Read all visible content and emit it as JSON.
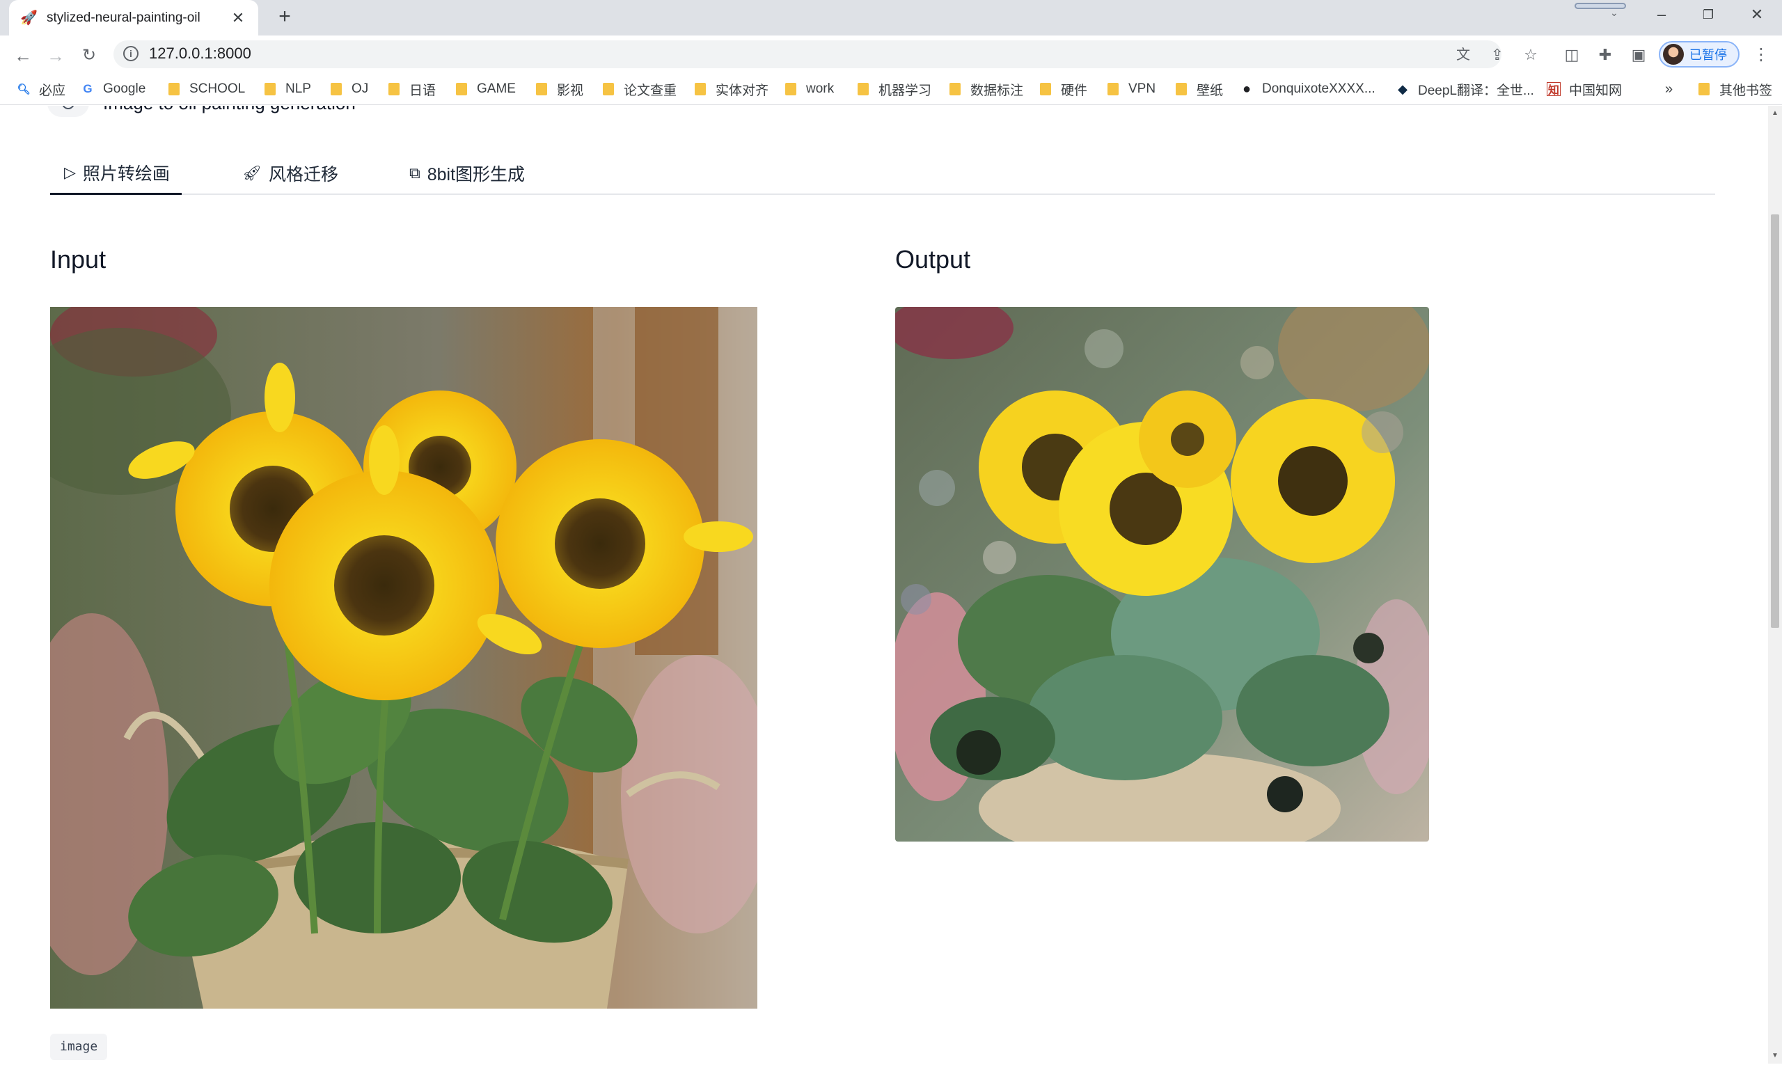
{
  "browser": {
    "tab_title": "stylized-neural-painting-oil",
    "tab_favicon": "🚀",
    "new_tab_symbol": "+",
    "url": "127.0.0.1:8000",
    "profile_label": "已暂停"
  },
  "bookmarks": [
    {
      "label": "必应",
      "icon": "search-icon"
    },
    {
      "label": "Google",
      "icon": "google-icon"
    },
    {
      "label": "SCHOOL",
      "icon": "folder-icon"
    },
    {
      "label": "NLP",
      "icon": "folder-icon"
    },
    {
      "label": "OJ",
      "icon": "folder-icon"
    },
    {
      "label": "日语",
      "icon": "folder-icon"
    },
    {
      "label": "GAME",
      "icon": "folder-icon"
    },
    {
      "label": "影视",
      "icon": "folder-icon"
    },
    {
      "label": "论文查重",
      "icon": "folder-icon"
    },
    {
      "label": "实体对齐",
      "icon": "folder-icon"
    },
    {
      "label": "work",
      "icon": "folder-icon"
    },
    {
      "label": "机器学习",
      "icon": "folder-icon"
    },
    {
      "label": "数据标注",
      "icon": "folder-icon"
    },
    {
      "label": "硬件",
      "icon": "folder-icon"
    },
    {
      "label": "VPN",
      "icon": "folder-icon"
    },
    {
      "label": "壁纸",
      "icon": "folder-icon"
    },
    {
      "label": "DonquixoteXXXX...",
      "icon": "github-icon"
    },
    {
      "label": "DeepL翻译：全世...",
      "icon": "deepl-icon"
    },
    {
      "label": "中国知网",
      "icon": "cnki-icon"
    },
    {
      "label": "其他书签",
      "icon": "folder-icon"
    }
  ],
  "bookmarks_overflow": "»",
  "page": {
    "cut_heading": "Image to oil painting generation",
    "tabs": [
      {
        "label": "照片转绘画",
        "icon": "play-icon",
        "active": true
      },
      {
        "label": "风格迁移",
        "icon": "rocket-icon",
        "active": false
      },
      {
        "label": "8bit图形生成",
        "icon": "frame-icon",
        "active": false
      }
    ],
    "input_label": "Input",
    "output_label": "Output",
    "image_chip": "image"
  }
}
